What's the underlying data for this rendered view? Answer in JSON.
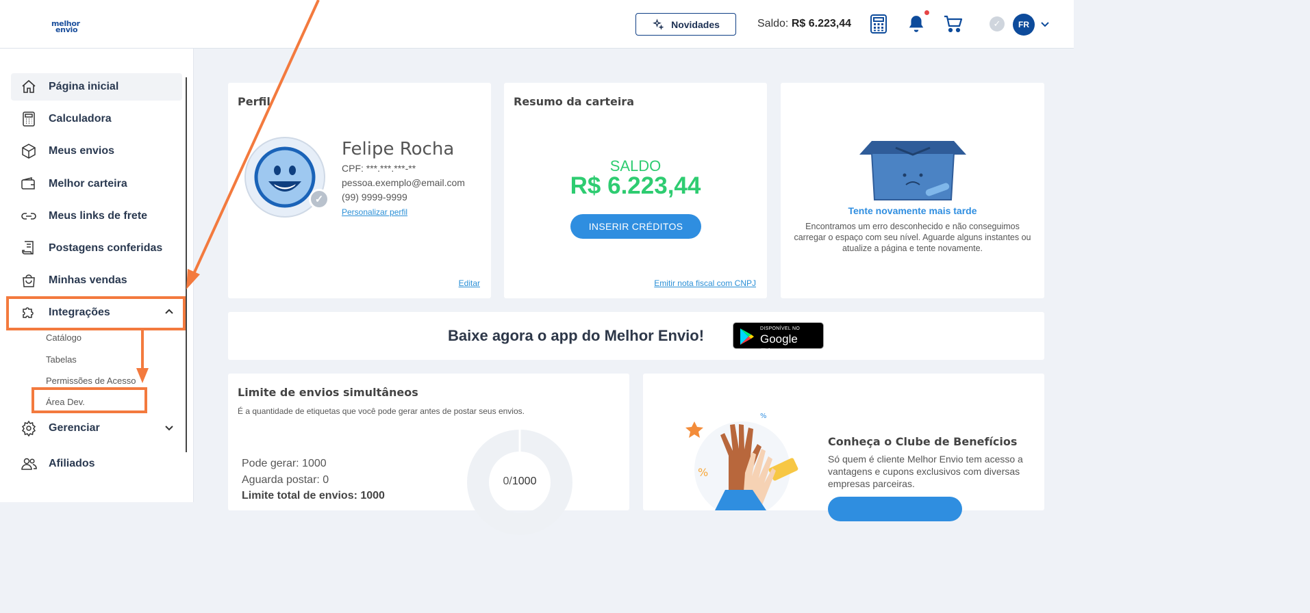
{
  "brand": {
    "logo_line1": "melhor",
    "logo_line2": "envio"
  },
  "header": {
    "novidades_label": "Novidades",
    "saldo_label": "Saldo:",
    "saldo_value": "R$ 6.223,44",
    "avatar_initials": "FR"
  },
  "sidebar": {
    "items": [
      {
        "label": "Página inicial",
        "icon": "home-icon"
      },
      {
        "label": "Calculadora",
        "icon": "calculator-icon"
      },
      {
        "label": "Meus envios",
        "icon": "box-icon"
      },
      {
        "label": "Melhor carteira",
        "icon": "wallet-icon"
      },
      {
        "label": "Meus links de frete",
        "icon": "link-icon"
      },
      {
        "label": "Postagens conferidas",
        "icon": "receipt-icon"
      },
      {
        "label": "Minhas vendas",
        "icon": "bag-icon"
      },
      {
        "label": "Integrações",
        "icon": "puzzle-icon"
      },
      {
        "label": "Gerenciar",
        "icon": "gear-icon"
      },
      {
        "label": "Afiliados",
        "icon": "users-icon"
      }
    ],
    "submenu": [
      "Catálogo",
      "Tabelas",
      "Permissões de Acesso",
      "Área Dev."
    ]
  },
  "profile": {
    "title": "Perfil",
    "name": "Felipe Rocha",
    "cpf": "CPF: ***.***.***-**",
    "email": "pessoa.exemplo@email.com",
    "phone": "(99) 9999-9999",
    "customize_link": "Personalizar perfil",
    "edit_link": "Editar"
  },
  "wallet": {
    "title": "Resumo da carteira",
    "saldo_label": "SALDO",
    "saldo_value": "R$ 6.223,44",
    "button": "INSERIR CRÉDITOS",
    "invoice_link": "Emitir nota fiscal com CNPJ"
  },
  "level": {
    "error_title": "Tente novamente mais tarde",
    "error_text": "Encontramos um erro desconhecido e não conseguimos carregar o espaço com seu nível. Aguarde alguns instantes ou atualize a página e tente novamente."
  },
  "app_banner": {
    "text": "Baixe agora o app do Melhor Envio!",
    "badge_small": "DISPONÍVEL NO",
    "badge_big": "Google Play"
  },
  "limits": {
    "title": "Limite de envios simultâneos",
    "subtitle": "É a quantidade de etiquetas que você pode gerar antes de postar seus envios.",
    "can_generate": "Pode gerar: 1000",
    "awaiting": "Aguarda postar: 0",
    "total": "Limite total de envios: 1000",
    "donut_used": "0/",
    "donut_total": "1000",
    "used_fraction": 0
  },
  "club": {
    "title": "Conheça o Clube de Benefícios",
    "text": "Só quem é cliente Melhor Envio tem acesso a vantagens e cupons exclusivos com diversas empresas parceiras."
  },
  "colors": {
    "accent": "#2f8ee0",
    "highlight": "#f37a3e",
    "saldo": "#2ecc71",
    "navy": "#0d4b9b"
  }
}
